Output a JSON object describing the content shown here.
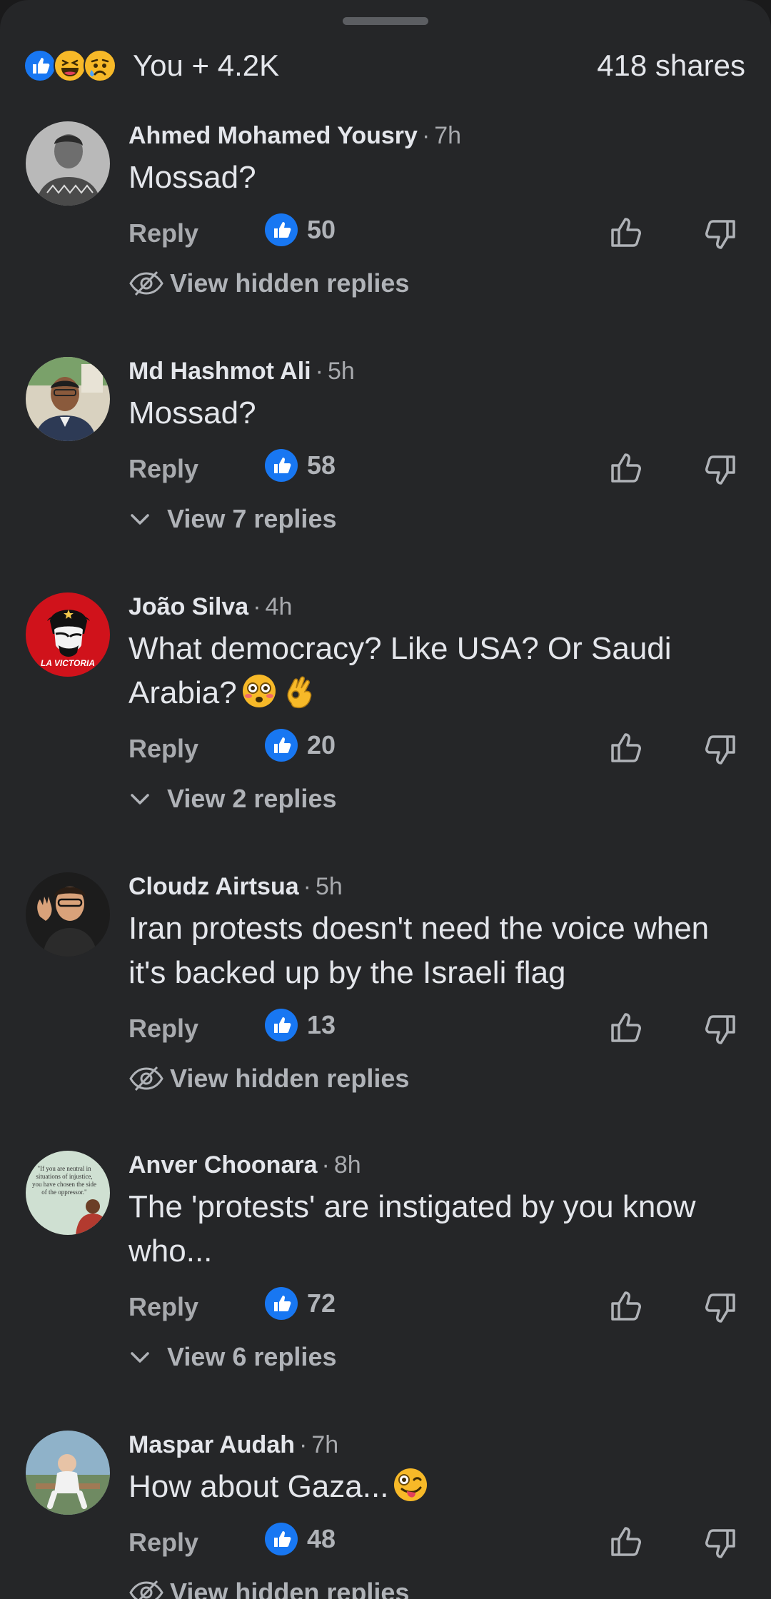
{
  "summary": {
    "reactions": [
      "like-icon",
      "haha-icon",
      "sad-icon"
    ],
    "reaction_total": "You + 4.2K",
    "shares": "418 shares"
  },
  "colors": {
    "background": "#252628",
    "accent": "#1877f2",
    "secondary_text": "#a8aaae"
  },
  "comments": [
    {
      "author": "Ahmed Mohamed Yousry",
      "time": "7h",
      "text": "Mossad?",
      "emojis": [],
      "reply_label": "Reply",
      "likes": "50",
      "thread": {
        "type": "hidden",
        "label": "View hidden replies"
      }
    },
    {
      "author": "Md Hashmot Ali",
      "time": "5h",
      "text": "Mossad?",
      "emojis": [],
      "reply_label": "Reply",
      "likes": "58",
      "thread": {
        "type": "replies",
        "label": "View 7 replies"
      }
    },
    {
      "author": "João Silva",
      "time": "4h",
      "text": "What democracy? Like USA? Or Saudi Arabia?",
      "emojis": [
        "flushed-face-emoji",
        "ok-hand-emoji"
      ],
      "avatar_text": "LA VICTORIA",
      "reply_label": "Reply",
      "likes": "20",
      "thread": {
        "type": "replies",
        "label": "View 2 replies"
      }
    },
    {
      "author": "Cloudz Airtsua",
      "time": "5h",
      "text": "Iran protests doesn't need the voice when it's backed up by the Israeli flag",
      "emojis": [],
      "reply_label": "Reply",
      "likes": "13",
      "thread": {
        "type": "hidden",
        "label": "View hidden replies"
      }
    },
    {
      "author": "Anver Choonara",
      "time": "8h",
      "text": "The 'protests' are instigated by you know who...",
      "emojis": [],
      "avatar_text": "\"If you are neutral in situations of injustice, you have chosen the side of the oppressor.\"",
      "reply_label": "Reply",
      "likes": "72",
      "thread": {
        "type": "replies",
        "label": "View 6 replies"
      }
    },
    {
      "author": "Maspar Audah",
      "time": "7h",
      "text": "How about Gaza...",
      "emojis": [
        "zany-face-emoji"
      ],
      "reply_label": "Reply",
      "likes": "48",
      "thread": {
        "type": "hidden",
        "label": "View hidden replies"
      }
    }
  ]
}
